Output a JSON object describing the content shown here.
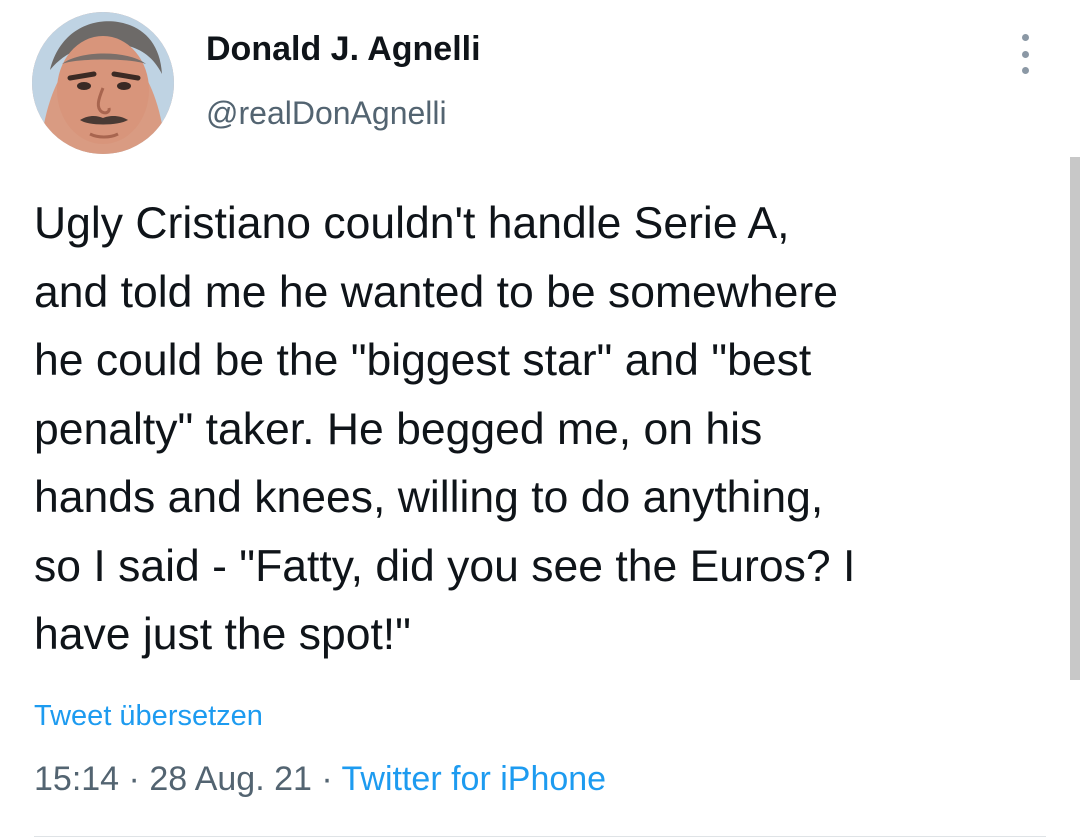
{
  "user": {
    "display_name": "Donald J. Agnelli",
    "handle": "@realDonAgnelli"
  },
  "tweet": {
    "text": "Ugly Cristiano couldn't handle Serie A,\nand told me he wanted to be somewhere\nhe could be the \"biggest star\" and \"best\npenalty\" taker. He begged me, on his\nhands and knees, willing to do anything,\nso I said - \"Fatty, did you see the Euros? I\nhave just the spot!\"",
    "translate_label": "Tweet übersetzen",
    "time": "15:14",
    "date": "28 Aug. 21",
    "separator": " · ",
    "source": "Twitter for iPhone"
  },
  "icons": {
    "more": "more-vertical-icon"
  },
  "colors": {
    "link": "#1d9bf0",
    "secondary_text": "#536471",
    "primary_text": "#0f1419"
  }
}
